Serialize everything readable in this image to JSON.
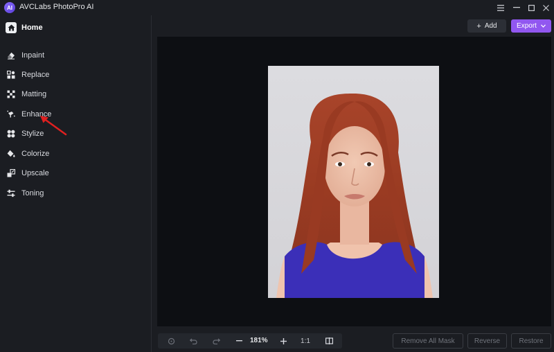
{
  "window": {
    "title": "AVCLabs PhotoPro AI",
    "logo_text": "AI"
  },
  "sidebar": {
    "home_label": "Home",
    "items": [
      {
        "label": "Inpaint",
        "icon": "eraser-icon"
      },
      {
        "label": "Replace",
        "icon": "replace-icon"
      },
      {
        "label": "Matting",
        "icon": "matting-icon"
      },
      {
        "label": "Enhance",
        "icon": "enhance-icon"
      },
      {
        "label": "Stylize",
        "icon": "stylize-icon"
      },
      {
        "label": "Colorize",
        "icon": "bucket-icon"
      },
      {
        "label": "Upscale",
        "icon": "upscale-icon"
      },
      {
        "label": "Toning",
        "icon": "sliders-icon"
      }
    ]
  },
  "toolbar": {
    "add_label": "Add",
    "export_label": "Export"
  },
  "bottom": {
    "zoom": "181%",
    "ratio": "1:1",
    "remove_mask_label": "Remove All Mask",
    "reverse_label": "Reverse",
    "restore_label": "Restore"
  },
  "colors": {
    "accent": "#9157f0",
    "background": "#1b1d22",
    "canvas": "#0d0f13"
  }
}
